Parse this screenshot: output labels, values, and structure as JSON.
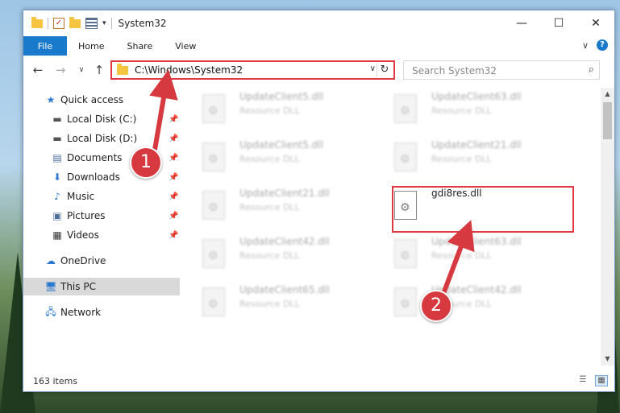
{
  "window": {
    "title": "System32",
    "minimize_glyph": "—",
    "maximize_glyph": "☐",
    "close_glyph": "✕"
  },
  "quick_access_toolbar": {
    "icons": [
      "folder-icon",
      "properties-check-icon",
      "new-folder-icon",
      "properties-icon",
      "customize-dropdown-icon"
    ]
  },
  "ribbon": {
    "tabs": [
      "File",
      "Home",
      "Share",
      "View"
    ],
    "expand_glyph": "∨",
    "help_glyph": "?"
  },
  "navigation": {
    "back_glyph": "←",
    "forward_glyph": "→",
    "recent_glyph": "∨",
    "up_glyph": "↑",
    "address_path": "C:\\Windows\\System32",
    "address_dropdown_glyph": "∨",
    "refresh_glyph": "↻",
    "search_placeholder": "Search System32",
    "search_glyph": "⌕"
  },
  "sidebar": {
    "items": [
      {
        "label": "Quick access",
        "icon": "star-icon",
        "pinned": false
      },
      {
        "label": "Local Disk (C:)",
        "icon": "drive-icon",
        "pinned": true
      },
      {
        "label": "Local Disk (D:)",
        "icon": "drive-icon",
        "pinned": true
      },
      {
        "label": "Documents",
        "icon": "documents-icon",
        "pinned": true
      },
      {
        "label": "Downloads",
        "icon": "download-icon",
        "pinned": true
      },
      {
        "label": "Music",
        "icon": "music-icon",
        "pinned": true
      },
      {
        "label": "Pictures",
        "icon": "pictures-icon",
        "pinned": true
      },
      {
        "label": "Videos",
        "icon": "videos-icon",
        "pinned": true
      },
      {
        "label": "OneDrive",
        "icon": "cloud-icon",
        "pinned": false
      },
      {
        "label": "This PC",
        "icon": "computer-icon",
        "pinned": false,
        "selected": true
      },
      {
        "label": "Network",
        "icon": "network-icon",
        "pinned": false
      }
    ],
    "pin_glyph": "📌"
  },
  "files": [
    {
      "name": "UpdateClient5.dll",
      "type": "Resource DLL"
    },
    {
      "name": "UpdateClient63.dll",
      "type": "Resource DLL"
    },
    {
      "name": "UpdateClient5.dll",
      "type": "Resource DLL"
    },
    {
      "name": "UpdateClient21.dll",
      "type": "Resource DLL"
    },
    {
      "name": "UpdateClient21.dll",
      "type": "Resource DLL"
    },
    {
      "name": "gdi8res.dll",
      "type": "",
      "highlighted": true
    },
    {
      "name": "UpdateClient42.dll",
      "type": "Resource DLL"
    },
    {
      "name": "UpdateClient63.dll",
      "type": "Resource DLL"
    },
    {
      "name": "UpdateClient65.dll",
      "type": "Resource DLL"
    },
    {
      "name": "UpdateClient42.dll",
      "type": "Resource DLL"
    }
  ],
  "status": {
    "item_count": "163 items"
  },
  "annotations": {
    "step1": "1",
    "step2": "2",
    "highlight_color": "#e2383f",
    "badge_color": "#d6393f"
  },
  "colors": {
    "accent": "#1979ca"
  }
}
